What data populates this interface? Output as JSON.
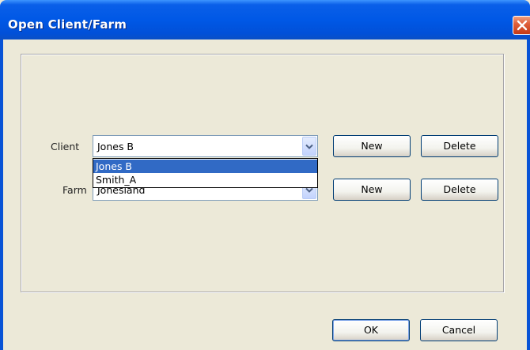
{
  "window": {
    "title": "Open Client/Farm"
  },
  "client": {
    "label": "Client",
    "value": "Jones B",
    "options": [
      "Jones B",
      "Smith_A"
    ],
    "new_label": "New",
    "delete_label": "Delete"
  },
  "farm": {
    "label": "Farm",
    "value": "Jonesland",
    "new_label": "New",
    "delete_label": "Delete"
  },
  "footer": {
    "ok_label": "OK",
    "cancel_label": "Cancel"
  },
  "colors": {
    "titlebar": "#0058e6",
    "dialog_bg": "#ece9d8",
    "selection": "#316ac5",
    "close_button": "#c43a16"
  },
  "icons": [
    "close-icon",
    "chevron-down-icon"
  ]
}
